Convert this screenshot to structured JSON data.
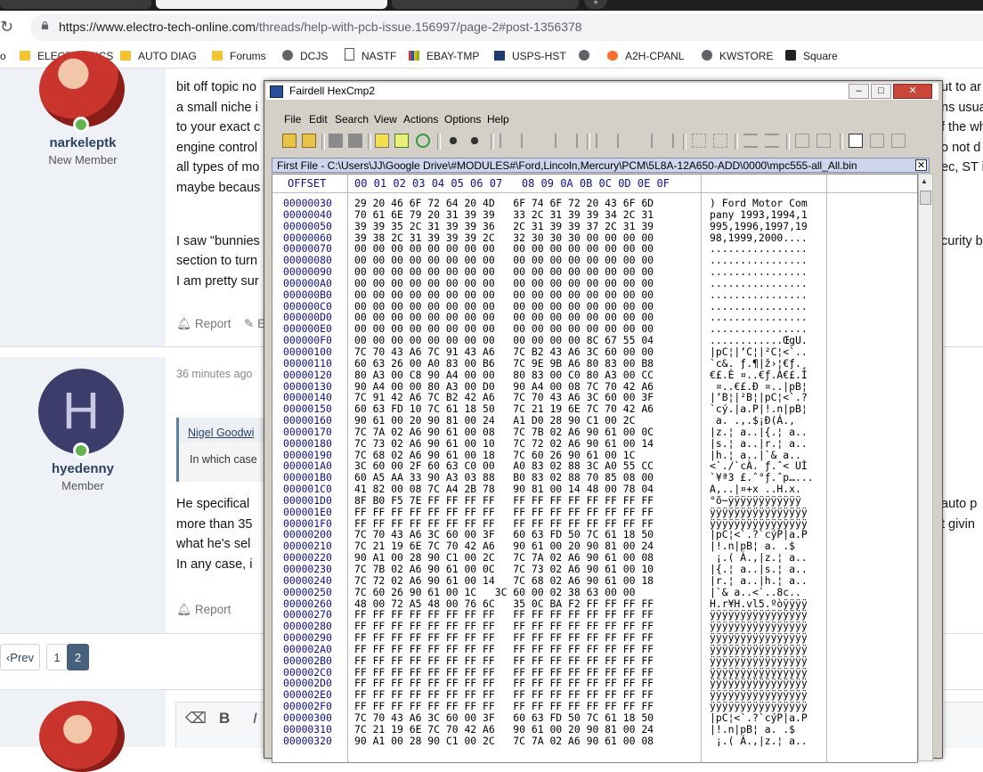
{
  "browser": {
    "url_host": "https://www.electro-tech-online.com",
    "url_path": "/threads/help-with-pcb-issue.156997/page-2#post-1356378",
    "reload_icon": "reload-icon",
    "bookmarks": [
      {
        "label": "o",
        "icon": "none"
      },
      {
        "label": "ELECTRONICS",
        "icon": "folder-icon"
      },
      {
        "label": "AUTO DIAG",
        "icon": "folder-icon"
      },
      {
        "label": "Forums",
        "icon": "folder-icon"
      },
      {
        "label": "DCJS",
        "icon": "globe-icon"
      },
      {
        "label": "NASTF",
        "icon": "document-icon"
      },
      {
        "label": "EBAY-TMP",
        "icon": "ebay-icon"
      },
      {
        "label": "USPS-HST",
        "icon": "usps-icon"
      },
      {
        "label": "",
        "icon": "globe-icon"
      },
      {
        "label": "A2H-CPANL",
        "icon": "cpanel-icon"
      },
      {
        "label": "KWSTORE",
        "icon": "globe-icon"
      },
      {
        "label": "Square",
        "icon": "square-icon"
      }
    ]
  },
  "forum": {
    "post1": {
      "username": "narkeleptk",
      "user_title": "New Member",
      "lines": [
        "bit off topic no",
        "a small niche i",
        "to your exact c",
        "engine control",
        "all types of mo",
        "maybe becaus",
        "",
        "I saw \"bunnies",
        "section to turn",
        "I am pretty sur"
      ],
      "right_fragments": [
        "ut to ar",
        "ns usual",
        "f the wh",
        "o not d",
        "ec, ST is",
        "",
        "",
        "curity b"
      ],
      "report": "Report",
      "edit": "E"
    },
    "post2": {
      "time": "36 minutes ago",
      "avatar_letter": "H",
      "username": "hyedenny",
      "user_title": "Member",
      "quote_author": "Nigel Goodwi",
      "quote_text": "In which case",
      "lines": [
        "He specifical",
        "more than 35",
        "what he's sel",
        "In any case, i"
      ],
      "right_fragments": [
        "auto p",
        "t givin"
      ],
      "report": "Report"
    },
    "pager": {
      "prev": "Prev",
      "page1": "1",
      "page2": "2"
    },
    "editor": {
      "eraser": "eraser-icon",
      "bold": "B",
      "italic": "I"
    }
  },
  "hexcmp": {
    "title": "Fairdell HexCmp2",
    "window_buttons": {
      "minimize": "‒",
      "maximize": "□",
      "close": "✕"
    },
    "menu": [
      "File",
      "Edit",
      "Search",
      "View",
      "Actions",
      "Options",
      "Help"
    ],
    "file_label": "First File - C:\\Users\\JJ\\Google Drive\\#MODULES#\\Ford,Lincoln,Mercury\\PCM\\5L8A-12A650-ADD\\0000\\mpc555-all_All.bin",
    "offset_header": "OFFSET",
    "column_header": "00 01 02 03 04 05 06 07   08 09 0A 0B 0C 0D 0E 0F",
    "rows": [
      {
        "addr": "00000030",
        "hex": "29 20 46 6F 72 64 20 4D   6F 74 6F 72 20 43 6F 6D",
        "text": ") Ford Motor Com"
      },
      {
        "addr": "00000040",
        "hex": "70 61 6E 79 20 31 39 39   33 2C 31 39 39 34 2C 31",
        "text": "pany 1993,1994,1"
      },
      {
        "addr": "00000050",
        "hex": "39 39 35 2C 31 39 39 36   2C 31 39 39 37 2C 31 39",
        "text": "995,1996,1997,19"
      },
      {
        "addr": "00000060",
        "hex": "39 38 2C 31 39 39 39 2C   32 30 30 30 00 00 00 00",
        "text": "98,1999,2000...."
      },
      {
        "addr": "00000070",
        "hex": "00 00 00 00 00 00 00 00   00 00 00 00 00 00 00 00",
        "text": "................"
      },
      {
        "addr": "00000080",
        "hex": "00 00 00 00 00 00 00 00   00 00 00 00 00 00 00 00",
        "text": "................"
      },
      {
        "addr": "00000090",
        "hex": "00 00 00 00 00 00 00 00   00 00 00 00 00 00 00 00",
        "text": "................"
      },
      {
        "addr": "000000A0",
        "hex": "00 00 00 00 00 00 00 00   00 00 00 00 00 00 00 00",
        "text": "................"
      },
      {
        "addr": "000000B0",
        "hex": "00 00 00 00 00 00 00 00   00 00 00 00 00 00 00 00",
        "text": "................"
      },
      {
        "addr": "000000C0",
        "hex": "00 00 00 00 00 00 00 00   00 00 00 00 00 00 00 00",
        "text": "................"
      },
      {
        "addr": "000000D0",
        "hex": "00 00 00 00 00 00 00 00   00 00 00 00 00 00 00 00",
        "text": "................"
      },
      {
        "addr": "000000E0",
        "hex": "00 00 00 00 00 00 00 00   00 00 00 00 00 00 00 00",
        "text": "................"
      },
      {
        "addr": "000000F0",
        "hex": "00 00 00 00 00 00 00 00   00 00 00 00 8C 67 55 04",
        "text": "............ŒgU."
      },
      {
        "addr": "00000100",
        "hex": "7C 70 43 A6 7C 91 43 A6   7C B2 43 A6 3C 60 00 00",
        "text": "|pC¦|‘C¦|²C¦<`.."
      },
      {
        "addr": "00000110",
        "hex": "60 63 26 00 A0 83 00 B6   7C 9E 9B A6 80 83 00 B8",
        "text": "`c&. ƒ.¶|ž›¦€ƒ.¸"
      },
      {
        "addr": "00000120",
        "hex": "80 A3 00 C8 90 A4 00 00   80 83 00 C0 80 A3 00 CC",
        "text": "€£.È ¤..€ƒ.À€£.Ì"
      },
      {
        "addr": "00000130",
        "hex": "90 A4 00 00 80 A3 00 D0   90 A4 00 08 7C 70 42 A6",
        "text": " ¤..€£.Ð ¤..|pB¦"
      },
      {
        "addr": "00000140",
        "hex": "7C 91 42 A6 7C B2 42 A6   7C 70 43 A6 3C 60 00 3F",
        "text": "|‘B¦|²B¦|pC¦<`.?"
      },
      {
        "addr": "00000150",
        "hex": "60 63 FD 10 7C 61 18 50   7C 21 19 6E 7C 70 42 A6",
        "text": "`cý.|a.P|!.n|pB¦"
      },
      {
        "addr": "00000160",
        "hex": "90 61 00 20 90 81 00 24   A1 D0 28 90 C1 00 2C",
        "text": " a. .‚.$¡Ð(Á.,"
      },
      {
        "addr": "00000170",
        "hex": "7C 7A 02 A6 90 61 00 08   7C 7B 02 A6 90 61 00 0C",
        "text": "|z.¦ a..|{.¦ a.."
      },
      {
        "addr": "00000180",
        "hex": "7C 73 02 A6 90 61 00 10   7C 72 02 A6 90 61 00 14",
        "text": "|s.¦ a..|r.¦ a.."
      },
      {
        "addr": "00000190",
        "hex": "7C 68 02 A6 90 61 00 18   7C 60 26 90 61 00 1C",
        "text": "|h.¦ a..|`& a.."
      },
      {
        "addr": "000001A0",
        "hex": "3C 60 00 2F 60 63 C0 00   A0 83 02 88 3C A0 55 CC",
        "text": "<`./`cÀ. ƒ.ˆ< UÌ"
      },
      {
        "addr": "000001B0",
        "hex": "60 A5 AA 33 90 A3 03 88   B0 83 02 88 70 85 08 00",
        "text": "`¥ª3 £.ˆ°ƒ.ˆp…..."
      },
      {
        "addr": "000001C0",
        "hex": "41 82 00 08 7C A4 2B 78   90 81 00 14 48 00 78 04",
        "text": "A‚..|¤+x ..H.x."
      },
      {
        "addr": "000001D0",
        "hex": "8F B0 F5 7E FF FF FF FF   FF FF FF FF FF FF FF FF",
        "text": "°õ~ÿÿÿÿÿÿÿÿÿÿÿÿ"
      },
      {
        "addr": "000001E0",
        "hex": "FF FF FF FF FF FF FF FF   FF FF FF FF FF FF FF FF",
        "text": "ÿÿÿÿÿÿÿÿÿÿÿÿÿÿÿÿ"
      },
      {
        "addr": "000001F0",
        "hex": "FF FF FF FF FF FF FF FF   FF FF FF FF FF FF FF FF",
        "text": "ÿÿÿÿÿÿÿÿÿÿÿÿÿÿÿÿ"
      },
      {
        "addr": "00000200",
        "hex": "7C 70 43 A6 3C 60 00 3F   60 63 FD 50 7C 61 18 50",
        "text": "|pC¦<`.?`cýP|a.P"
      },
      {
        "addr": "00000210",
        "hex": "7C 21 19 6E 7C 70 42 A6   90 61 00 20 90 81 00 24",
        "text": "|!.n|pB¦ a. .$"
      },
      {
        "addr": "00000220",
        "hex": "90 A1 00 28 90 C1 00 2C   7C 7A 02 A6 90 61 00 08",
        "text": " ¡.( Á.,|z.¦ a.."
      },
      {
        "addr": "00000230",
        "hex": "7C 7B 02 A6 90 61 00 0C   7C 73 02 A6 90 61 00 10",
        "text": "|{.¦ a..|s.¦ a.."
      },
      {
        "addr": "00000240",
        "hex": "7C 72 02 A6 90 61 00 14   7C 68 02 A6 90 61 00 18",
        "text": "|r.¦ a..|h.¦ a.."
      },
      {
        "addr": "00000250",
        "hex": "7C 60 26 90 61 00 1C   3C 60 00 02 38 63 00 00",
        "text": "|`& a..<`..8c.."
      },
      {
        "addr": "00000260",
        "hex": "48 00 72 A5 48 00 76 6C   35 0C BA F2 FF FF FF FF",
        "text": "H.r¥H.vl5.ºòÿÿÿÿ"
      },
      {
        "addr": "00000270",
        "hex": "FF FF FF FF FF FF FF FF   FF FF FF FF FF FF FF FF",
        "text": "ÿÿÿÿÿÿÿÿÿÿÿÿÿÿÿÿ"
      },
      {
        "addr": "00000280",
        "hex": "FF FF FF FF FF FF FF FF   FF FF FF FF FF FF FF FF",
        "text": "ÿÿÿÿÿÿÿÿÿÿÿÿÿÿÿÿ"
      },
      {
        "addr": "00000290",
        "hex": "FF FF FF FF FF FF FF FF   FF FF FF FF FF FF FF FF",
        "text": "ÿÿÿÿÿÿÿÿÿÿÿÿÿÿÿÿ"
      },
      {
        "addr": "000002A0",
        "hex": "FF FF FF FF FF FF FF FF   FF FF FF FF FF FF FF FF",
        "text": "ÿÿÿÿÿÿÿÿÿÿÿÿÿÿÿÿ"
      },
      {
        "addr": "000002B0",
        "hex": "FF FF FF FF FF FF FF FF   FF FF FF FF FF FF FF FF",
        "text": "ÿÿÿÿÿÿÿÿÿÿÿÿÿÿÿÿ"
      },
      {
        "addr": "000002C0",
        "hex": "FF FF FF FF FF FF FF FF   FF FF FF FF FF FF FF FF",
        "text": "ÿÿÿÿÿÿÿÿÿÿÿÿÿÿÿÿ"
      },
      {
        "addr": "000002D0",
        "hex": "FF FF FF FF FF FF FF FF   FF FF FF FF FF FF FF FF",
        "text": "ÿÿÿÿÿÿÿÿÿÿÿÿÿÿÿÿ"
      },
      {
        "addr": "000002E0",
        "hex": "FF FF FF FF FF FF FF FF   FF FF FF FF FF FF FF FF",
        "text": "ÿÿÿÿÿÿÿÿÿÿÿÿÿÿÿÿ"
      },
      {
        "addr": "000002F0",
        "hex": "FF FF FF FF FF FF FF FF   FF FF FF FF FF FF FF FF",
        "text": "ÿÿÿÿÿÿÿÿÿÿÿÿÿÿÿÿ"
      },
      {
        "addr": "00000300",
        "hex": "7C 70 43 A6 3C 60 00 3F   60 63 FD 50 7C 61 18 50",
        "text": "|pC¦<`.?`cýP|a.P"
      },
      {
        "addr": "00000310",
        "hex": "7C 21 19 6E 7C 70 42 A6   90 61 00 20 90 81 00 24",
        "text": "|!.n|pB¦ a. .$"
      },
      {
        "addr": "00000320",
        "hex": "90 A1 00 28 90 C1 00 2C   7C 7A 02 A6 90 61 00 08",
        "text": " ¡.( Á.,|z.¦ a.."
      }
    ]
  },
  "colors": {
    "accent": "#2b4361",
    "online": "#63b34f",
    "hex_address": "#10108a",
    "file_bar": "#cdd6ec"
  }
}
